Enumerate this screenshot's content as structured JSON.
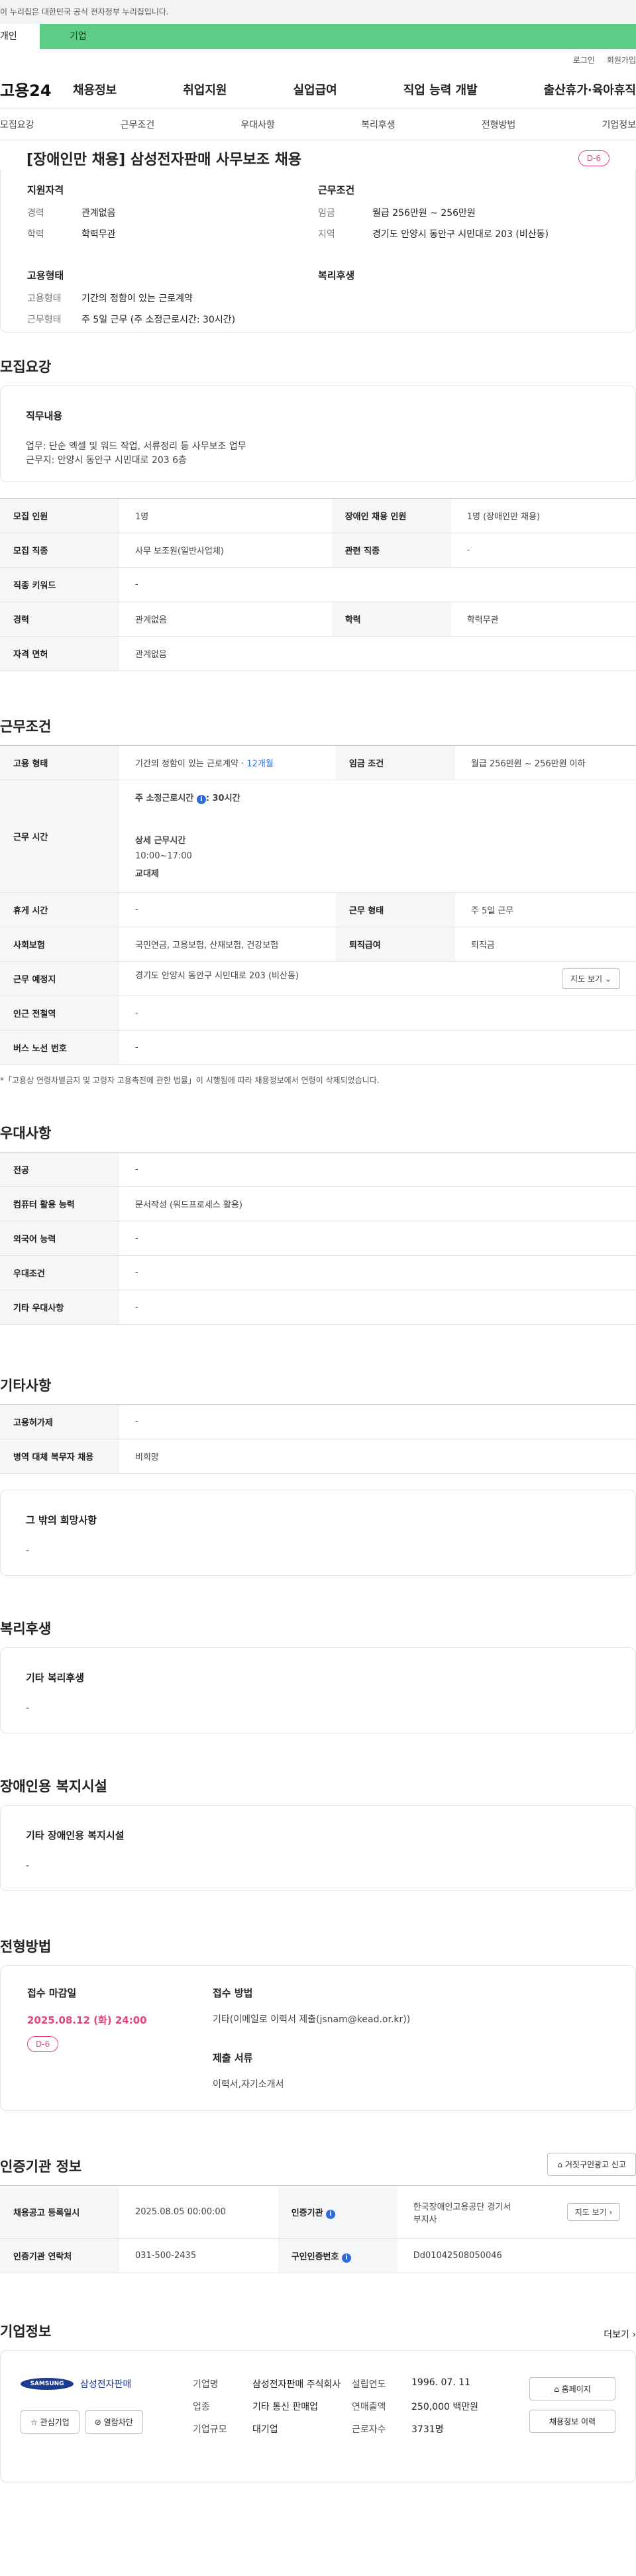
{
  "gov_bar": "이 누리집은 대한민국 공식 전자정부 누리집입니다.",
  "user_tabs": [
    "개인",
    "기업"
  ],
  "util_links": [
    "로그인",
    "회원가입"
  ],
  "logo": "고용24",
  "gnb": [
    "채용정보",
    "취업지원",
    "실업급여",
    "직업 능력 개발",
    "출산휴가·육아휴직"
  ],
  "tabnav": [
    "모집요강",
    "근무조건",
    "우대사항",
    "복리후생",
    "전형방법",
    "기업정보"
  ],
  "job": {
    "title": "[장애인만 채용] 삼성전자판매 사무보조 채용",
    "dday": "D-6",
    "qualification_h": "지원자격",
    "career_k": "경력",
    "career_v": "관계없음",
    "edu_k": "학력",
    "edu_v": "학력무관",
    "cond_h": "근무조건",
    "wage_k": "임금",
    "wage_v": "월급 256만원 ~ 256만원",
    "region_k": "지역",
    "region_v": "경기도 안양시 동안구 시민대로 203 (비산동)",
    "emp_h": "고용형태",
    "emptype_k": "고용형태",
    "emptype_v": "기간의 정함이 있는 근로계약",
    "worktype_k": "근무형태",
    "worktype_v": "주 5일 근무 (주 소정근로시간: 30시간)",
    "welfare_h": "복리후생"
  },
  "recruit": {
    "heading": "모집요강",
    "duty_h": "직무내용",
    "duty_l1": "업무: 단순 엑셀 및 워드 작업, 서류정리 등 사무보조 업무",
    "duty_l2": "근무지: 안양시 동안구 시민대로 203 6층",
    "rows": [
      [
        "모집 인원",
        "1명",
        "장애인 채용 인원",
        "1명 (장애인만 채용)"
      ],
      [
        "모집 직종",
        "사무 보조원(일반사업체)",
        "관련 직종",
        "-"
      ],
      [
        "직종 키워드",
        "-",
        "",
        ""
      ],
      [
        "경력",
        "관계없음",
        "학력",
        "학력무관"
      ],
      [
        "자격 면허",
        "관계없음",
        "",
        ""
      ]
    ]
  },
  "work": {
    "heading": "근무조건",
    "emptype_k": "고용 형태",
    "emptype_v": "기간의 정함이 있는 근로계약 · ",
    "emptype_months": "12개월",
    "wage_k": "임금 조건",
    "wage_v": "월급 256만원 ~ 256만원 이하",
    "hours_k": "근무 시간",
    "hours_week": "주 소정근로시간",
    "hours_week_v": ": 30시간",
    "hours_detail_h": "상세 근무시간",
    "hours_detail_v": "10:00~17:00",
    "hours_shift": "교대제",
    "rest_k": "휴게 시간",
    "rest_v": "-",
    "worktype_k": "근무 형태",
    "worktype_v": "주 5일 근무",
    "insurance_k": "사회보험",
    "insurance_v": "국민연금, 고용보험, 산재보험, 건강보험",
    "retire_k": "퇴직급여",
    "retire_v": "퇴직금",
    "place_k": "근무 예정지",
    "place_v": "경기도 안양시 동안구 시민대로 203 (비산동)",
    "map_btn": "지도 보기",
    "subway_k": "인근 전철역",
    "subway_v": "-",
    "bus_k": "버스 노선 번호",
    "bus_v": "-",
    "note": "*「고용상 연령차별금지 및 고령자 고용촉진에 관한 법률」이 시행됨에 따라 채용정보에서 연령이 삭제되었습니다."
  },
  "prefer": {
    "heading": "우대사항",
    "rows": [
      [
        "전공",
        "-"
      ],
      [
        "컴퓨터 활용 능력",
        "문서작성 (워드프로세스 활용)"
      ],
      [
        "외국어 능력",
        "-"
      ],
      [
        "우대조건",
        "-"
      ],
      [
        "기타 우대사항",
        "-"
      ]
    ]
  },
  "other": {
    "heading": "기타사항",
    "rows": [
      [
        "고용허가제",
        "-"
      ],
      [
        "병역 대체 복무자 채용",
        "비희망"
      ]
    ],
    "wish_h": "그 밖의 희망사항",
    "wish_v": "-"
  },
  "welfare": {
    "heading": "복리후생",
    "h": "기타 복리후생",
    "v": "-"
  },
  "facility": {
    "heading": "장애인용 복지시설",
    "h": "기타 장애인용 복지시설",
    "v": "-"
  },
  "selection": {
    "heading": "전형방법",
    "deadline_h": "접수 마감일",
    "deadline_v": "2025.08.12 (화) 24:00",
    "dday": "D-6",
    "method_h": "접수 방법",
    "method_v": "기타(이메일로 이력서 제출(jsnam@kead.or.kr))",
    "docs_h": "제출 서류",
    "docs_v": "이력서,자기소개서"
  },
  "cert": {
    "heading": "인증기관 정보",
    "report_btn": "거짓구인광고 신고",
    "reg_k": "채용공고 등록일시",
    "reg_v": "2025.08.05 00:00:00",
    "org_k": "인증기관",
    "org_v": "한국장애인고용공단 경기서부지사",
    "map_btn": "지도 보기",
    "tel_k": "인증기관 연락처",
    "tel_v": "031-500-2435",
    "no_k": "구인인증번호",
    "no_v": "Dd01042508050046"
  },
  "company": {
    "heading": "기업정보",
    "more": "더보기",
    "logo_mark": "SAMSUNG",
    "logo_text": "삼성전자판매",
    "interest_btn": "관심기업",
    "block_btn": "열람차단",
    "name_k": "기업명",
    "name_v": "삼성전자판매 주식회사",
    "industry_k": "업종",
    "industry_v": "기타 통신 판매업",
    "size_k": "기업규모",
    "size_v": "대기업",
    "founded_k": "설립연도",
    "founded_v": "1996. 07. 11",
    "sales_k": "연매출액",
    "sales_v": "250,000 백만원",
    "staff_k": "근로자수",
    "staff_v": "3731명",
    "home_btn": "홈페이지",
    "history_btn": "채용정보 이력"
  }
}
